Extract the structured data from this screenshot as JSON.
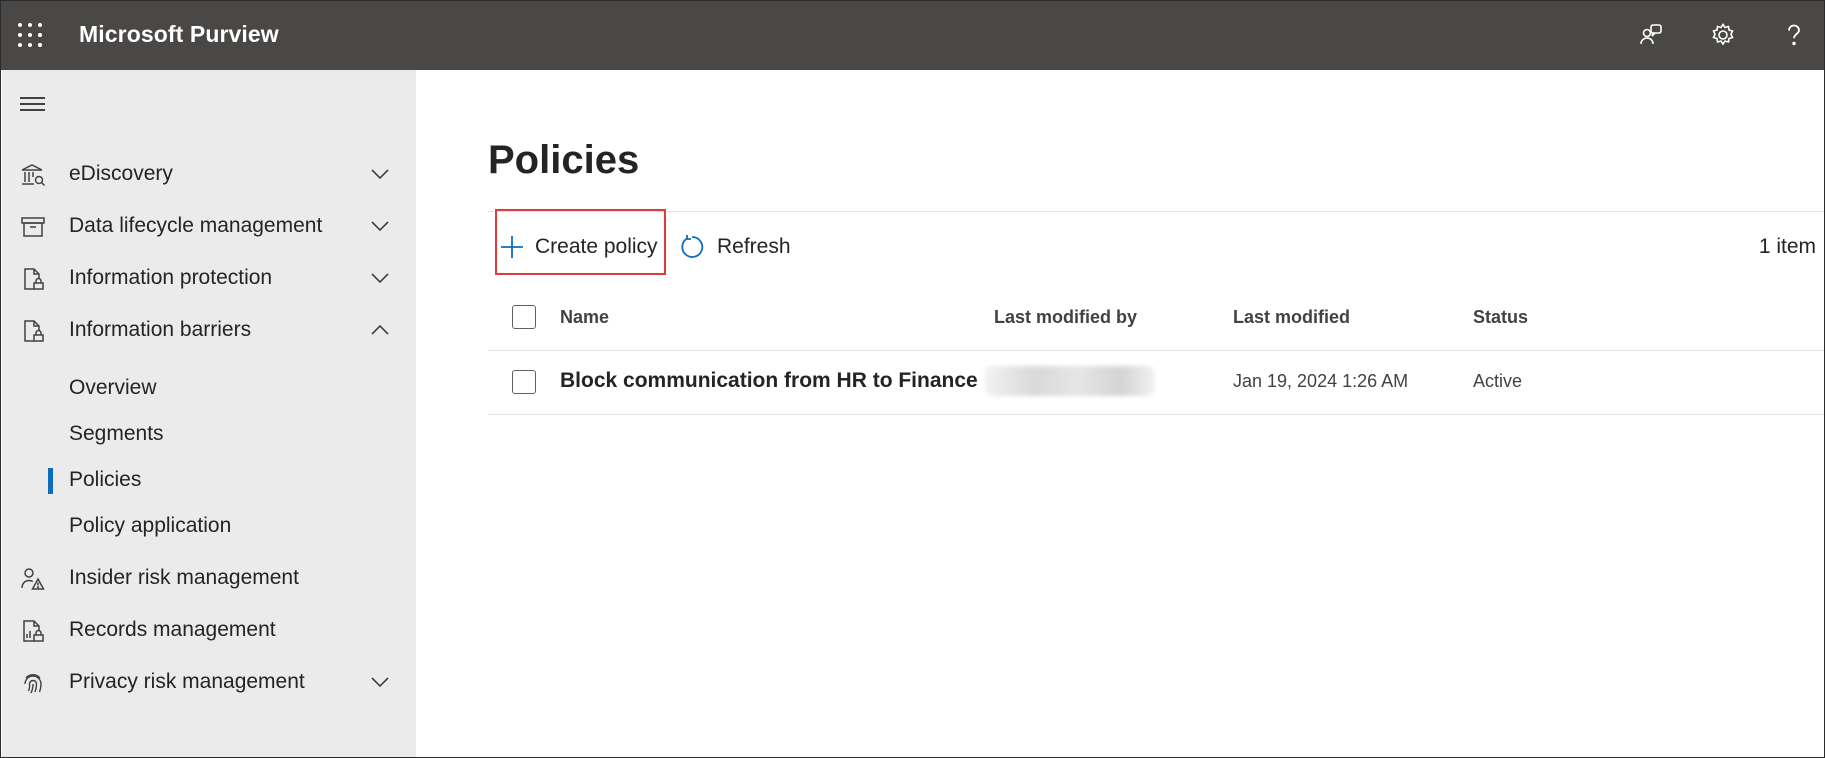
{
  "header": {
    "app_title": "Microsoft Purview",
    "icons": [
      "waffle-icon",
      "community-icon",
      "settings-icon",
      "help-icon"
    ]
  },
  "sidebar": {
    "items": [
      {
        "label": "eDiscovery",
        "icon": "ediscovery-icon",
        "chevron": "down"
      },
      {
        "label": "Data lifecycle management",
        "icon": "archive-icon",
        "chevron": "down"
      },
      {
        "label": "Information protection",
        "icon": "document-lock-icon",
        "chevron": "down"
      },
      {
        "label": "Information barriers",
        "icon": "document-lock-icon",
        "chevron": "up"
      },
      {
        "label": "Insider risk management",
        "icon": "person-warning-icon",
        "chevron": "none"
      },
      {
        "label": "Records management",
        "icon": "records-icon",
        "chevron": "none"
      },
      {
        "label": "Privacy risk management",
        "icon": "fingerprint-icon",
        "chevron": "down"
      }
    ],
    "sub_items": [
      {
        "label": "Overview",
        "active": false
      },
      {
        "label": "Segments",
        "active": false
      },
      {
        "label": "Policies",
        "active": true
      },
      {
        "label": "Policy application",
        "active": false
      }
    ]
  },
  "main": {
    "page_title": "Policies",
    "toolbar": {
      "create_label": "Create policy",
      "refresh_label": "Refresh",
      "item_count": "1 item"
    },
    "table": {
      "columns": [
        "Name",
        "Last modified by",
        "Last modified",
        "Status"
      ],
      "rows": [
        {
          "name": "Block communication from HR to Finance",
          "last_modified_by": "",
          "last_modified": "Jan 19, 2024 1:26 AM",
          "status": "Active"
        }
      ]
    }
  },
  "colors": {
    "header_bg": "#4a4846",
    "sidebar_bg": "#ebebeb",
    "accent": "#0f6cbd",
    "highlight_border": "#e03a3e"
  }
}
